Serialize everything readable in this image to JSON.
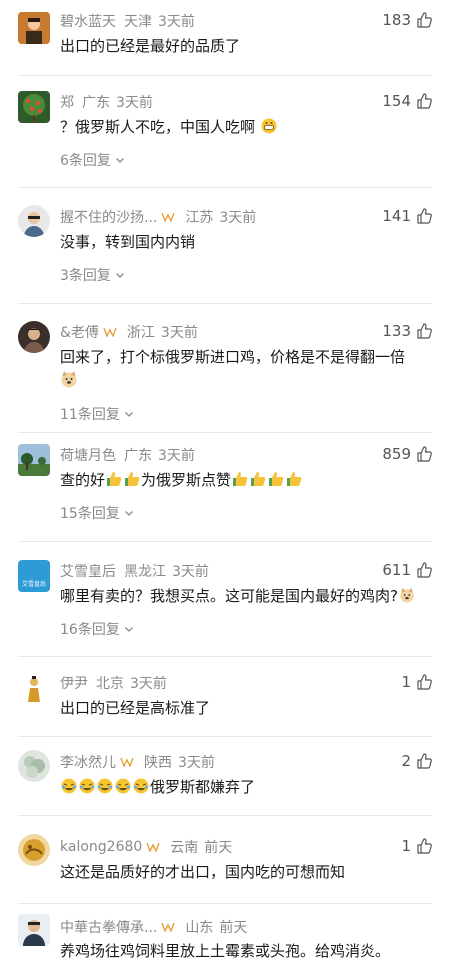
{
  "comments": [
    {
      "user": "碧水蓝天",
      "location": "天津",
      "time": "3天前",
      "likes": "183",
      "text": "出口的已经是最好的品质了"
    },
    {
      "user": "郑",
      "location": "广东",
      "time": "3天前",
      "likes": "154",
      "text": "？俄罗斯人不吃，中国人吃啊",
      "replies": "6条回复"
    },
    {
      "user": "握不住的沙扬...",
      "location": "江苏",
      "time": "3天前",
      "likes": "141",
      "text": "没事，转到国内内销",
      "replies": "3条回复"
    },
    {
      "user": "&老傅",
      "location": "浙江",
      "time": "3天前",
      "likes": "133",
      "text": "回来了，打个标俄罗斯进口鸡，价格是不是得翻一倍",
      "replies": "11条回复"
    },
    {
      "user": "荷塘月色",
      "location": "广东",
      "time": "3天前",
      "likes": "859",
      "text_a": "查的好",
      "text_b": "为俄罗斯点赞",
      "replies": "15条回复"
    },
    {
      "user": "艾雪皇后",
      "location": "黑龙江",
      "time": "3天前",
      "likes": "611",
      "text": "哪里有卖的？我想买点。这可能是国内最好的鸡肉?",
      "replies": "16条回复",
      "avatar_text": "艾雪皇后"
    },
    {
      "user": "伊尹",
      "location": "北京",
      "time": "3天前",
      "likes": "1",
      "text": "出口的已经是高标准了"
    },
    {
      "user": "李冰然儿",
      "location": "陕西",
      "time": "3天前",
      "likes": "2",
      "text": "俄罗斯都嫌弃了"
    },
    {
      "user": "kalong2680",
      "location": "云南",
      "time": "前天",
      "likes": "1",
      "text": "这还是品质好的才出口，国内吃的可想而知"
    },
    {
      "user": "中華古拳傳承...",
      "location": "山东",
      "time": "前天",
      "likes": "",
      "text": "养鸡场往鸡饲料里放上土霉素或头孢。给鸡消炎。"
    }
  ],
  "colors": {
    "meta": "#8a8a8a",
    "text": "#1a1a1a",
    "badge": "#e6a23c"
  },
  "icons": {
    "like": "thumbs-up-icon",
    "expand": "chevron-down-icon",
    "badge": "vip-badge-icon"
  }
}
